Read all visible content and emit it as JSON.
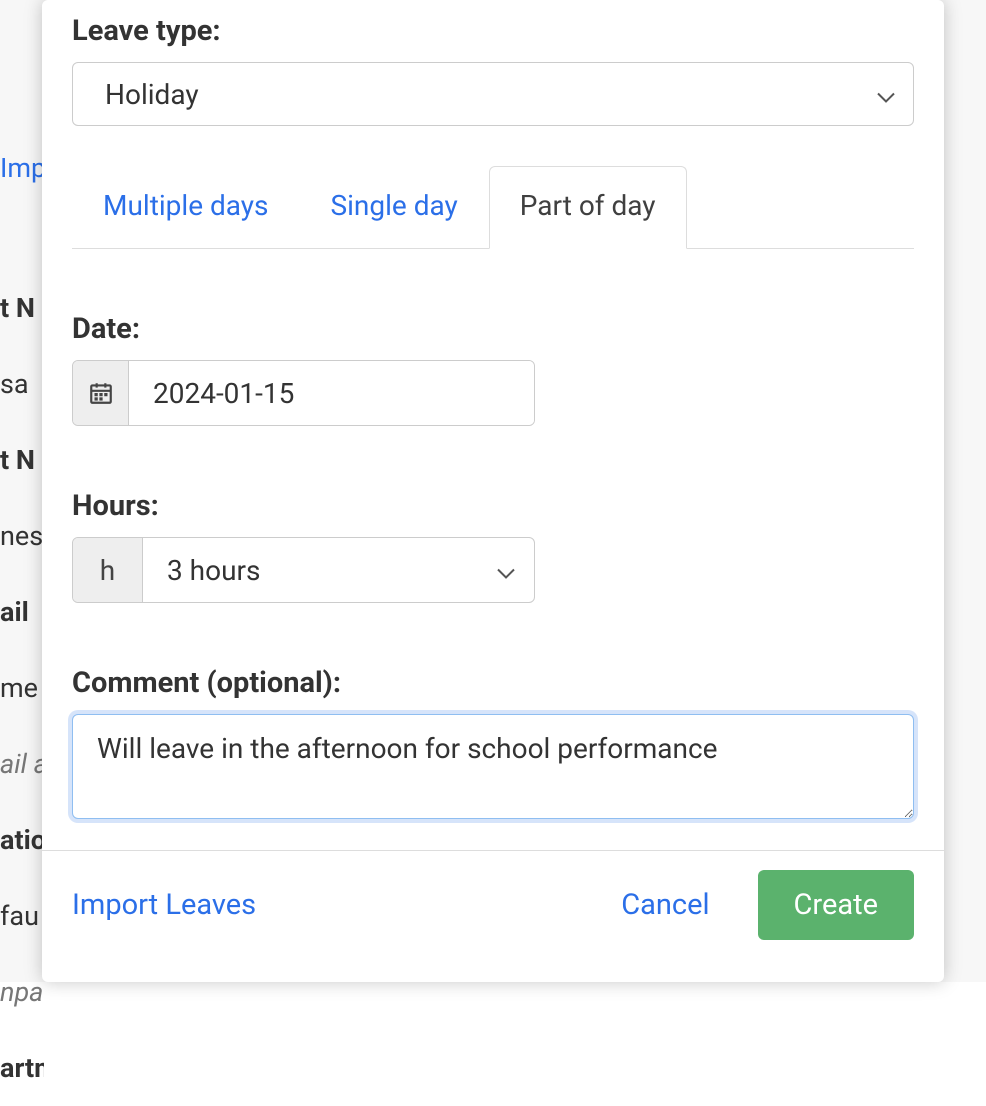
{
  "bg": {
    "link": "Imp",
    "row1": "t N",
    "row2": "sa",
    "row3": "t N",
    "row4": "nes",
    "row5": "ail",
    "row6": "me",
    "row7": "ail a",
    "row8": "atio",
    "row9": "fau",
    "row10": "npa",
    "row11": "artment"
  },
  "form": {
    "leave_type": {
      "label": "Leave type:",
      "value": "Holiday"
    },
    "tabs": {
      "multiple": "Multiple days",
      "single": "Single day",
      "part": "Part of day",
      "active": "part"
    },
    "date": {
      "label": "Date:",
      "value": "2024-01-15"
    },
    "hours": {
      "label": "Hours:",
      "addon": "h",
      "value": "3 hours"
    },
    "comment": {
      "label": "Comment (optional):",
      "value": "Will leave in the afternoon for school performance"
    }
  },
  "footer": {
    "import_label": "Import Leaves",
    "cancel_label": "Cancel",
    "create_label": "Create"
  }
}
